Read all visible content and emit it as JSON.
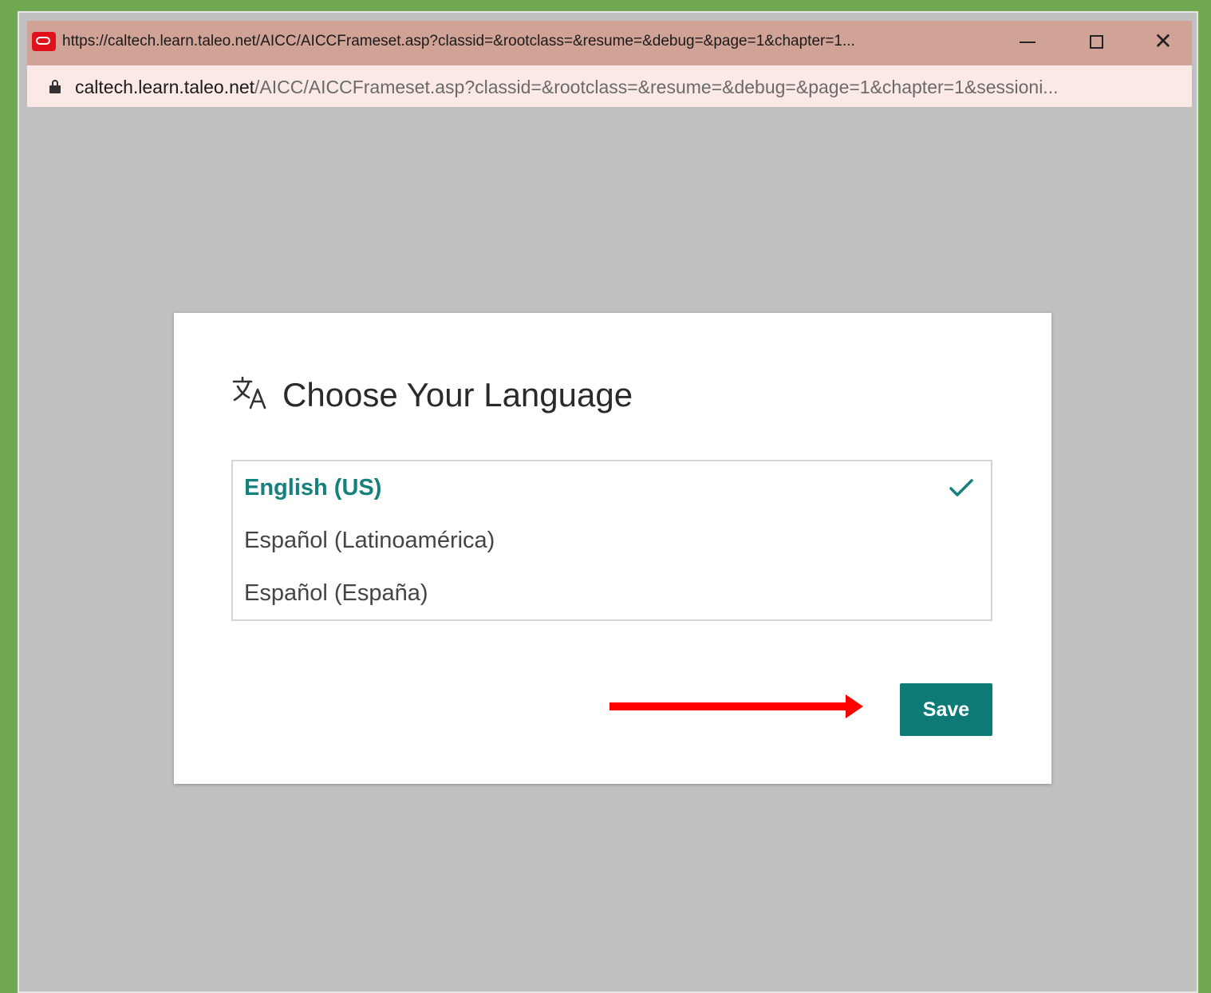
{
  "window": {
    "title": "https://caltech.learn.taleo.net/AICC/AICCFrameset.asp?classid=&rootclass=&resume=&debug=&page=1&chapter=1...",
    "controls": {
      "minimize_icon": "minimize-icon",
      "maximize_icon": "maximize-icon",
      "close_icon": "close-icon",
      "close_glyph": "✕"
    }
  },
  "address_bar": {
    "host": "caltech.learn.taleo.net",
    "path": "/AICC/AICCFrameset.asp?classid=&rootclass=&resume=&debug=&page=1&chapter=1&sessioni..."
  },
  "dialog": {
    "title": "Choose Your Language",
    "icon": "translate-icon",
    "languages": [
      {
        "label": "English (US)",
        "selected": true
      },
      {
        "label": "Español (Latinoamérica)",
        "selected": false
      },
      {
        "label": "Español (España)",
        "selected": false
      }
    ],
    "save_label": "Save"
  },
  "colors": {
    "accent": "#0d7a75",
    "selected_text": "#15807c",
    "arrow": "#ff0000",
    "background_frame": "#6fa851",
    "titlebar": "#d1a296",
    "addressbar": "#fbe9e6",
    "page_overlay": "#c0c0c0"
  }
}
